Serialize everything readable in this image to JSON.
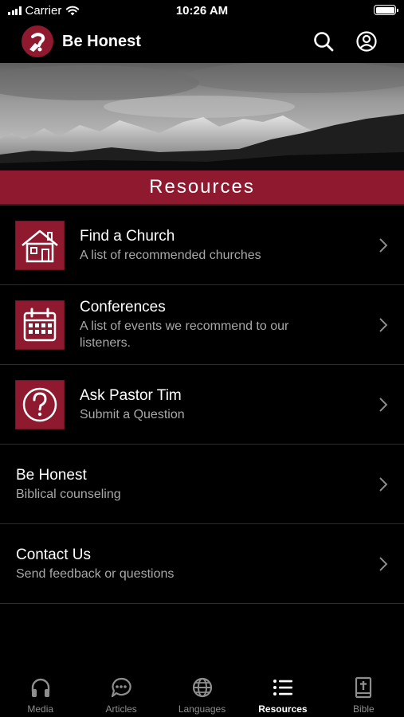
{
  "status_bar": {
    "carrier": "Carrier",
    "time": "10:26 AM"
  },
  "header": {
    "title": "Be Honest"
  },
  "section": {
    "title": "Resources"
  },
  "resources": [
    {
      "title": "Find a Church",
      "subtitle": "A list of recommended churches",
      "icon": "house-icon"
    },
    {
      "title": "Conferences",
      "subtitle": "A list of events we recommend to our listeners.",
      "icon": "calendar-icon"
    },
    {
      "title": "Ask Pastor Tim",
      "subtitle": "Submit a Question",
      "icon": "question-icon"
    },
    {
      "title": "Be Honest",
      "subtitle": "Biblical counseling"
    },
    {
      "title": "Contact Us",
      "subtitle": "Send feedback or questions"
    }
  ],
  "tabs": [
    {
      "label": "Media",
      "icon": "headphones-icon"
    },
    {
      "label": "Articles",
      "icon": "chat-bubble-icon"
    },
    {
      "label": "Languages",
      "icon": "globe-icon"
    },
    {
      "label": "Resources",
      "icon": "list-icon",
      "active": true
    },
    {
      "label": "Bible",
      "icon": "bible-icon"
    }
  ],
  "colors": {
    "accent": "#8f1a2f",
    "background": "#000000",
    "subtitle": "#a8a8a8",
    "tab_inactive": "#8e8e8e"
  }
}
